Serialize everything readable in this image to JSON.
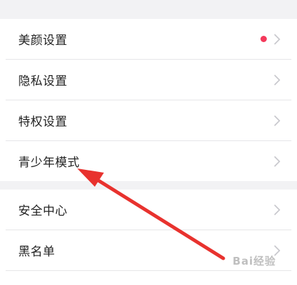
{
  "settings": {
    "group1": [
      {
        "label": "美颜设置",
        "has_dot": true
      },
      {
        "label": "隐私设置",
        "has_dot": false
      },
      {
        "label": "特权设置",
        "has_dot": false
      },
      {
        "label": "青少年模式",
        "has_dot": false
      }
    ],
    "group2": [
      {
        "label": "安全中心",
        "has_dot": false
      },
      {
        "label": "黑名单",
        "has_dot": false
      }
    ]
  },
  "icons": {
    "row_chevron": "chevron-right-icon",
    "badge": "red-dot-badge"
  },
  "colors": {
    "dot": "#f4395b",
    "arrow": "#e8322e",
    "gap": "#f2f2f4",
    "text": "#222222",
    "chevron": "#c7c7cc"
  },
  "watermark": {
    "text": "Bai经验"
  }
}
